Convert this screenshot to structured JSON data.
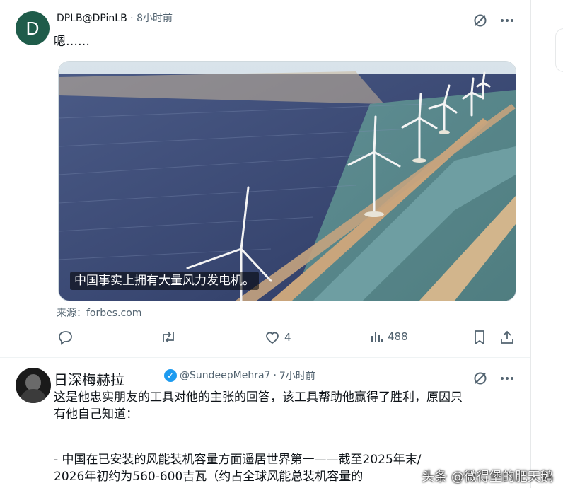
{
  "post1": {
    "author_handle": "DPLB@DPinLB",
    "time": "8小时前",
    "avatar_letter": "D",
    "text": "嗯……",
    "media_caption": "中国事实上拥有大量风力发电机。",
    "source": "来源：forbes.com",
    "likes": "4",
    "views": "488"
  },
  "post2": {
    "author_name": "日深梅赫拉",
    "author_handle": "@SundeepMehra7",
    "time": "7小时前",
    "text_line1": "这是他忠实朋友的工具对他的主张的回答，该工具帮助他赢得了胜利，原因只",
    "text_line2": "有他自己知道：",
    "text_line3": "- 中国在已安装的风能装机容量方面遥居世界第一——截至2025年末/",
    "text_line4": "2026年初约为560-600吉瓦（约占全球风能总装机容量的"
  },
  "watermark": "头条 @微得堡的肥天鹅",
  "icons": [
    "grok-icon",
    "more-icon",
    "reply-icon",
    "repost-icon",
    "like-icon",
    "views-icon",
    "bookmark-icon",
    "share-icon",
    "verified-icon"
  ],
  "colors": {
    "accent": "#1d9bf0",
    "muted": "#536471",
    "avatar_bg": "#1f5c4a"
  }
}
